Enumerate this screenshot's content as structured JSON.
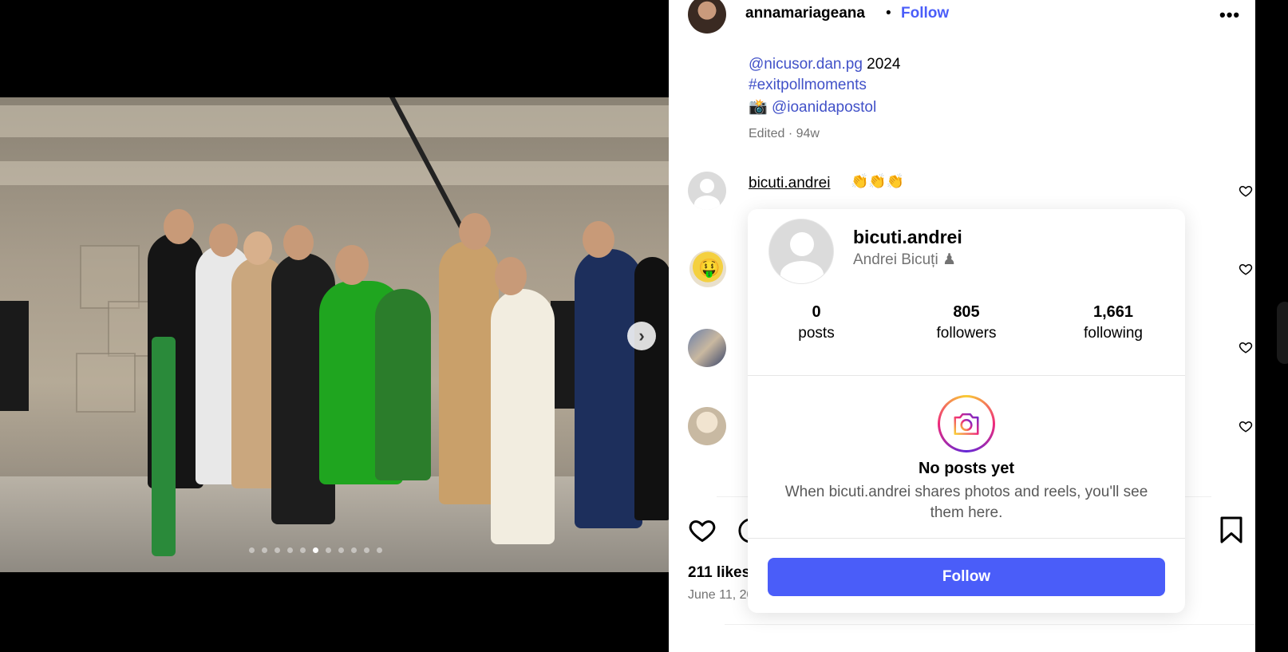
{
  "post": {
    "author": "annamariageana",
    "header_separator": "•",
    "follow_label": "Follow",
    "more_label": "•••",
    "caption_lines": [
      {
        "mention": "@nicusor.dan.pg",
        "text": " 2024"
      },
      {
        "hashtag": "#exitpollmoments"
      },
      {
        "camera_emoji": "📸",
        "mention": "@ioanidapostol"
      }
    ],
    "edited": "Edited · 94w",
    "likes": "211 likes",
    "date": "June 11, 2024"
  },
  "comments": [
    {
      "username": "bicuti.andrei",
      "text": "👏👏👏",
      "avatar": "default-avatar"
    },
    {
      "avatar": "emoji-avatar"
    },
    {
      "avatar": "photo-avatar"
    },
    {
      "avatar": "photo-avatar"
    }
  ],
  "hovercard": {
    "username": "bicuti.andrei",
    "full_name": "Andrei Bicuți ♟",
    "stats": [
      {
        "value": "0",
        "label": "posts"
      },
      {
        "value": "805",
        "label": "followers"
      },
      {
        "value": "1,661",
        "label": "following"
      }
    ],
    "empty_title": "No posts yet",
    "empty_description": "When bicuti.andrei shares photos and reels, you'll see them here.",
    "follow_label": "Follow"
  },
  "carousel": {
    "dot_count": 11,
    "active_index": 5
  },
  "colors": {
    "link": "#4151c8",
    "follow_button": "#4a5df9",
    "muted_text": "#737373"
  },
  "icons": {
    "like": "heart-icon",
    "comment": "comment-icon",
    "save": "bookmark-icon",
    "next": "chevron-right-icon",
    "more": "more-horizontal-icon",
    "empty_state": "camera-icon"
  }
}
